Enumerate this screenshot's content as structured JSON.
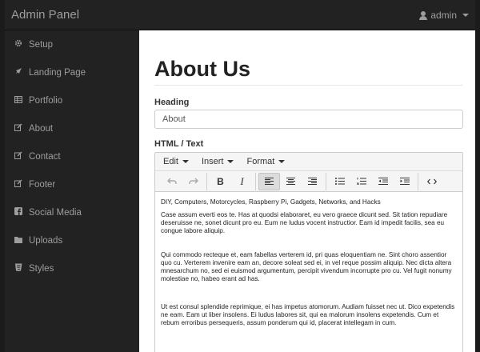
{
  "navbar": {
    "brand": "Admin Panel",
    "user": "admin"
  },
  "sidebar": {
    "items": [
      {
        "label": "Setup",
        "icon": "gear-icon"
      },
      {
        "label": "Landing Page",
        "icon": "rocket-icon"
      },
      {
        "label": "Portfolio",
        "icon": "grid-icon"
      },
      {
        "label": "About",
        "icon": "edit-icon"
      },
      {
        "label": "Contact",
        "icon": "edit-icon"
      },
      {
        "label": "Footer",
        "icon": "edit-icon"
      },
      {
        "label": "Social Media",
        "icon": "facebook-icon"
      },
      {
        "label": "Uploads",
        "icon": "folder-icon"
      },
      {
        "label": "Styles",
        "icon": "css-icon"
      }
    ]
  },
  "main": {
    "title": "About Us",
    "heading_label": "Heading",
    "heading_value": "About",
    "html_label": "HTML / Text"
  },
  "editor": {
    "menus": [
      "Edit",
      "Insert",
      "Format"
    ],
    "toolbar": [
      "undo-icon",
      "redo-icon",
      "bold-icon",
      "italic-icon",
      "align-left-icon",
      "align-center-icon",
      "align-right-icon",
      "bullet-list-icon",
      "numbered-list-icon",
      "outdent-icon",
      "indent-icon",
      "source-code-icon"
    ],
    "bold_glyph": "B",
    "italic_glyph": "I",
    "paragraphs": [
      "DIY, Computers, Motorcycles, Raspberry Pi, Gadgets, Networks, and Hacks",
      "Case assum everti eos te. Has at quodsi elaboraret, eu vero graece dicunt sed. Sit tation repudiare deseruisse ne, sonet dicunt pro eu. Eum ne ludus vocent instructior. Eam id impedit facilis, sea eu congue labore aliquip.",
      "Qui commodo recteque et, eam fabellas verterem id, pri quas eloquentiam ne. Sint choro assentior quo cu. Verterem invenire eam an, decore soleat sed ei, in vel reque possim aliquip. Nec dicta altera mnesarchum no, sed ei euismod argumentum, percipit vivendum incorrupte pro cu. Vel fugit nonumy molestiae no, habeo erant ad has.",
      "Ut est consul splendide reprimique, ei has impetus atomorum. Audiam fuisset nec ut. Dico expetendis ne eam. Eam ut liber insolens. Ei ludus labores sit, qui ea malorum insolens expetendis. Cum et rebum erroribus persequeris, assum ponderum qui id, placerat intellegam in cum."
    ]
  },
  "colors": {
    "dark": "#222222",
    "nav_text": "#9d9d9d",
    "active_button": "#dcdcdc"
  }
}
